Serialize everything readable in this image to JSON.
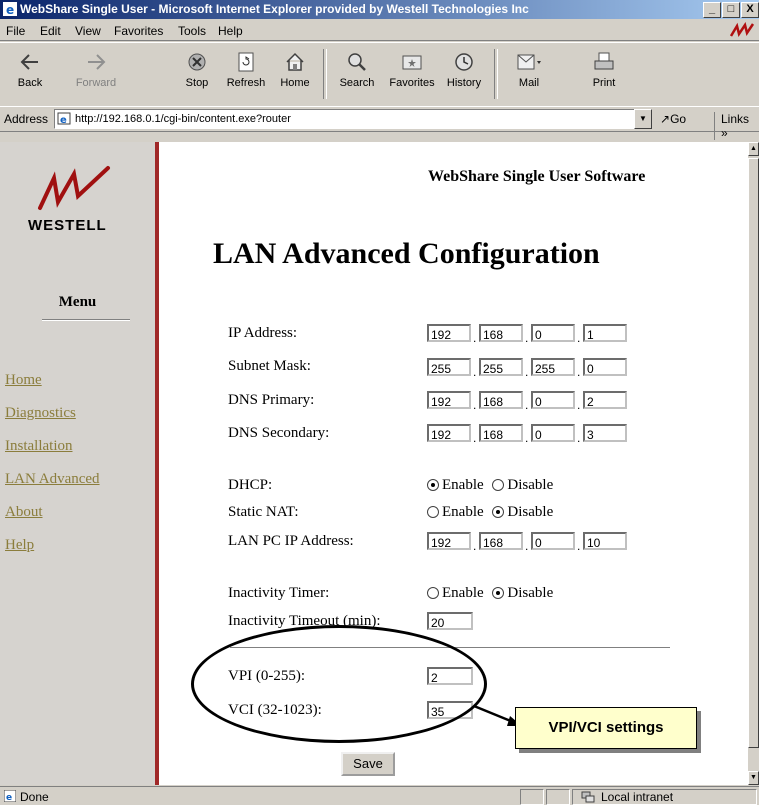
{
  "window": {
    "title": "WebShare Single User - Microsoft Internet Explorer provided by Westell Technologies Inc",
    "buttons": [
      "_",
      "□",
      "X"
    ]
  },
  "menubar": {
    "items": [
      "File",
      "Edit",
      "View",
      "Favorites",
      "Tools",
      "Help"
    ]
  },
  "toolbar": {
    "back": "Back",
    "forward": "Forward",
    "stop": "Stop",
    "refresh": "Refresh",
    "home": "Home",
    "search": "Search",
    "favorites": "Favorites",
    "history": "History",
    "mail": "Mail",
    "print": "Print"
  },
  "addressbar": {
    "label": "Address",
    "url": "http://192.168.0.1/cgi-bin/content.exe?router",
    "go": "Go",
    "links": "Links »"
  },
  "sidebar": {
    "logo_text": "WESTELL",
    "menu_title": "Menu",
    "links": [
      "Home",
      "Diagnostics",
      "Installation",
      "LAN Advanced",
      "About",
      "Help"
    ]
  },
  "main": {
    "header": "WebShare Single User Software",
    "title": "LAN Advanced Configuration",
    "ip_address": {
      "label": "IP Address:",
      "octets": [
        "192",
        "168",
        "0",
        "1"
      ]
    },
    "subnet_mask": {
      "label": "Subnet Mask:",
      "octets": [
        "255",
        "255",
        "255",
        "0"
      ]
    },
    "dns_primary": {
      "label": "DNS Primary:",
      "octets": [
        "192",
        "168",
        "0",
        "2"
      ]
    },
    "dns_secondary": {
      "label": "DNS Secondary:",
      "octets": [
        "192",
        "168",
        "0",
        "3"
      ]
    },
    "dhcp": {
      "label": "DHCP:",
      "enable": "Enable",
      "disable": "Disable",
      "selected": "Enable"
    },
    "static_nat": {
      "label": "Static NAT:",
      "enable": "Enable",
      "disable": "Disable",
      "selected": "Disable"
    },
    "lan_pc_ip": {
      "label": "LAN PC IP Address:",
      "octets": [
        "192",
        "168",
        "0",
        "10"
      ]
    },
    "inactivity_timer": {
      "label": "Inactivity Timer:",
      "enable": "Enable",
      "disable": "Disable",
      "selected": "Disable"
    },
    "inactivity_timeout": {
      "label": "Inactivity Timeout (min):",
      "value": "20"
    },
    "vpi": {
      "label": "VPI (0-255):",
      "value": "2"
    },
    "vci": {
      "label": "VCI (32-1023):",
      "value": "35"
    },
    "save": "Save",
    "callout": "VPI/VCI settings"
  },
  "statusbar": {
    "status": "Done",
    "zone": "Local intranet"
  }
}
